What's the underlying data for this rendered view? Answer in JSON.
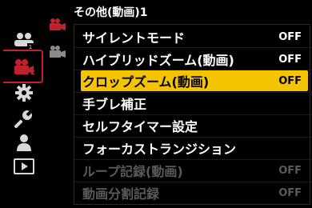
{
  "header": {
    "title": "その他(動画)1"
  },
  "colors": {
    "highlight": "#f5c400",
    "accent_red": "#c0222c",
    "disabled_text": "#5a5a5a"
  },
  "sidebar": {
    "icons": [
      {
        "name": "group-mode-icon"
      },
      {
        "name": "video-camera-icon",
        "badge": "2"
      },
      {
        "name": "gear-icon"
      },
      {
        "name": "wrench-icon"
      },
      {
        "name": "person-icon"
      },
      {
        "name": "play-icon"
      }
    ],
    "sub_icons": [
      {
        "name": "video-sub-icon-1"
      },
      {
        "name": "video-sub-icon-2"
      }
    ]
  },
  "menu": {
    "items": [
      {
        "label": "サイレントモード",
        "value": "OFF",
        "state": "normal"
      },
      {
        "label": "ハイブリッドズーム(動画)",
        "value": "OFF",
        "state": "normal"
      },
      {
        "label": "クロップズーム(動画)",
        "value": "OFF",
        "state": "selected"
      },
      {
        "label": "手ブレ補正",
        "value": "",
        "state": "normal"
      },
      {
        "label": "セルフタイマー設定",
        "value": "",
        "state": "normal"
      },
      {
        "label": "フォーカストランジション",
        "value": "",
        "state": "normal"
      },
      {
        "label": "ループ記録(動画)",
        "value": "OFF",
        "state": "disabled"
      },
      {
        "label": "動画分割記録",
        "value": "OFF",
        "state": "disabled"
      }
    ]
  }
}
